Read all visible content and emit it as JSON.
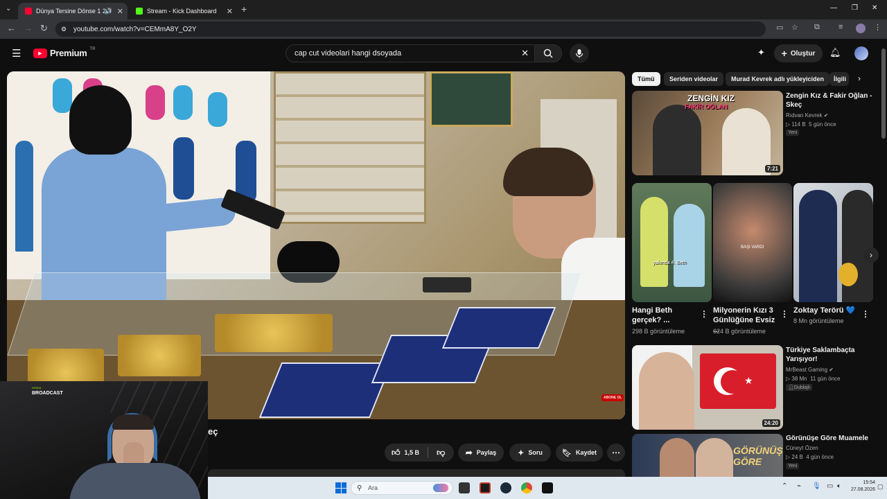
{
  "browser": {
    "tabs": [
      {
        "label": "Dünya Tersine Dönse 1 2 3",
        "active": true,
        "favicon_color": "#ff0033"
      },
      {
        "label": "Stream - Kick Dashboard",
        "active": false,
        "favicon_color": "#53fc18"
      }
    ],
    "new_tab": "+",
    "url": "youtube.com/watch?v=CEMmA8Y_O2Y",
    "window_controls": [
      "—",
      "❐",
      "✕"
    ]
  },
  "youtube": {
    "logo_text": "Premium",
    "logo_badge": "TR",
    "search_value": "cap cut videolari hangi dsoyada",
    "create_label": "Oluştur"
  },
  "video": {
    "overlay_badge": "ABONE OL",
    "title_fragment": "eç"
  },
  "webcam": {
    "brand_top": "NVIDIA",
    "brand_bottom": "BROADCAST"
  },
  "actions": {
    "likes": "1,5 B",
    "share": "Paylaş",
    "ask": "Soru",
    "save": "Kaydet"
  },
  "sidebar": {
    "chips": [
      "Tümü",
      "Seriden videolar",
      "Murad Kevrek adlı yükleyiciden",
      "İlgili"
    ],
    "videos": [
      {
        "title": "Zengin Kız & Fakir Oğlan - Skeç",
        "channel": "Rıdvan Kevrek",
        "views": "114 B",
        "age": "5 gün önce",
        "tag": "Yeni",
        "duration": "7:21",
        "thumb_caption_1": "ZENGİN KIZ",
        "thumb_caption_2": "FAKİR OĞLAN"
      },
      {
        "title": "Türkiye Saklambaçta Yarışıyor!",
        "channel": "MrBeast Gaming",
        "views": "38 Mn",
        "age": "11 gün önce",
        "tag": "Dublajlı",
        "duration": "24:20"
      },
      {
        "title": "Görünüşe Göre Muamele",
        "channel": "Cüneyt Özen",
        "views": "24 B",
        "age": "4 gün önce",
        "tag": "Yeni",
        "thumb_caption": "GÖRÜNÜŞE GÖRE"
      }
    ],
    "shorts": [
      {
        "title": "Hangi Beth gerçek? ...",
        "views": "298 B görüntüleme",
        "thumb_caption": "yakında 4. Beth"
      },
      {
        "title": "Milyonerin Kızı 3 Günlüğüne Evsiz ...",
        "views": "624 B görüntüleme",
        "thumb_caption": "BAŞI VARDI"
      },
      {
        "title": "Zoktay Terörü 💙",
        "views": "8 Mn görüntüleme"
      }
    ]
  },
  "taskbar": {
    "search_placeholder": "Ara",
    "time": "15:54",
    "date": "27.08.2026"
  }
}
